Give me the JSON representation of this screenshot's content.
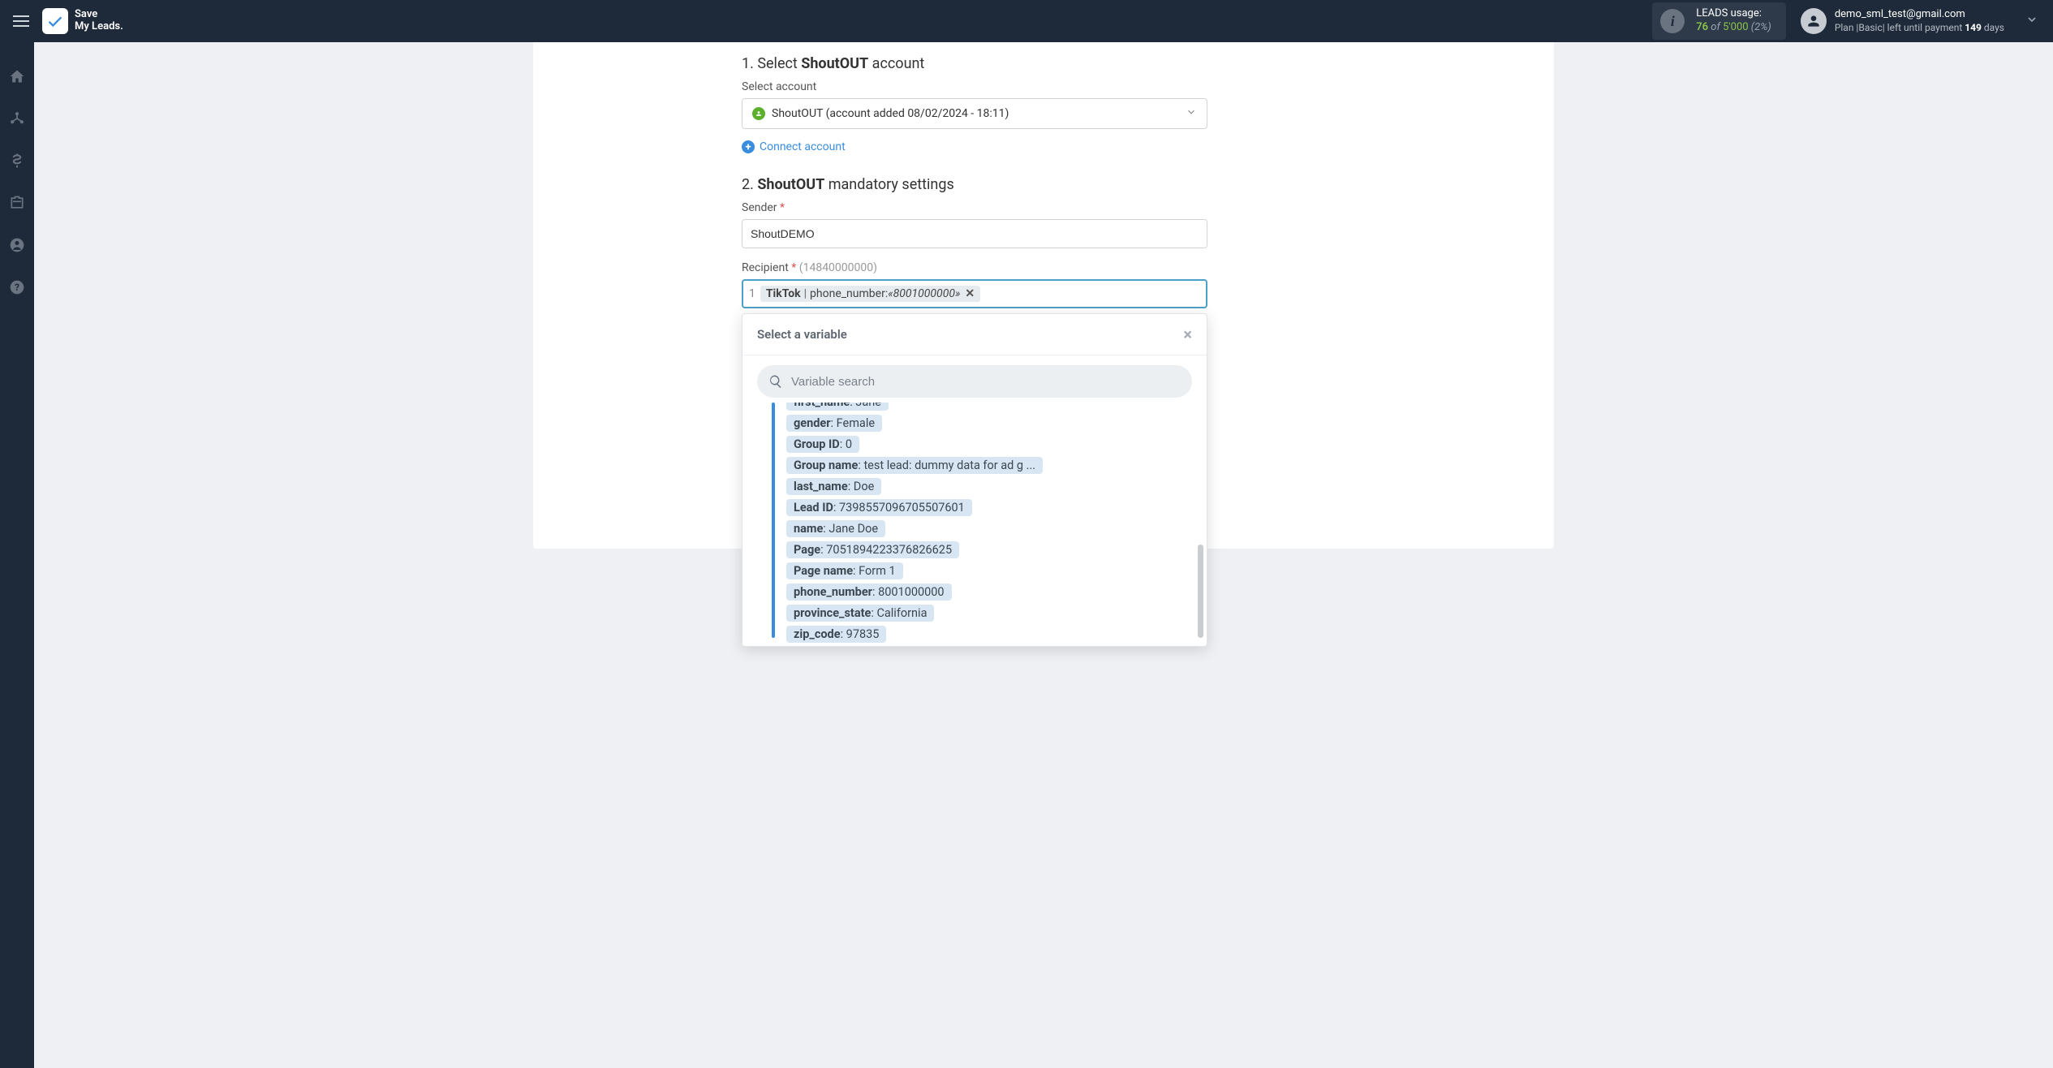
{
  "header": {
    "logo_line1": "Save",
    "logo_line2": "My Leads.",
    "usage_label": "LEADS usage:",
    "usage_used": "76",
    "usage_of": " of ",
    "usage_total": "5'000",
    "usage_pct": " (2%)",
    "user_email": "demo_sml_test@gmail.com",
    "user_plan_prefix": "Plan |Basic| left until payment ",
    "user_plan_days": "149",
    "user_plan_suffix": " days"
  },
  "section1": {
    "num": "1. ",
    "prefix": "Select ",
    "bold": "ShoutOUT",
    "suffix": " account",
    "select_label": "Select account",
    "account_value": "ShoutOUT (account added 08/02/2024 - 18:11)",
    "connect_label": "Connect account"
  },
  "section2": {
    "num": "2. ",
    "bold": "ShoutOUT",
    "suffix": " mandatory settings",
    "sender_label": "Sender",
    "sender_value": "ShoutDEMO",
    "recipient_label": "Recipient",
    "recipient_hint": "(14840000000)",
    "line_num": "1",
    "tag_source": "TikTok",
    "tag_field": "phone_number",
    "tag_value": "«8001000000»"
  },
  "dropdown": {
    "title": "Select a variable",
    "search_placeholder": "Variable search",
    "vars": [
      {
        "k": "first_name",
        "v": "Jane"
      },
      {
        "k": "gender",
        "v": "Female"
      },
      {
        "k": "Group ID",
        "v": "0"
      },
      {
        "k": "Group name",
        "v": "test lead: dummy data for ad g ..."
      },
      {
        "k": "last_name",
        "v": "Doe"
      },
      {
        "k": "Lead ID",
        "v": "7398557096705507601"
      },
      {
        "k": "name",
        "v": "Jane Doe"
      },
      {
        "k": "Page",
        "v": "7051894223376826625"
      },
      {
        "k": "Page name",
        "v": "Form 1"
      },
      {
        "k": "phone_number",
        "v": "8001000000"
      },
      {
        "k": "province_state",
        "v": "California"
      },
      {
        "k": "zip_code",
        "v": "97835"
      }
    ]
  }
}
